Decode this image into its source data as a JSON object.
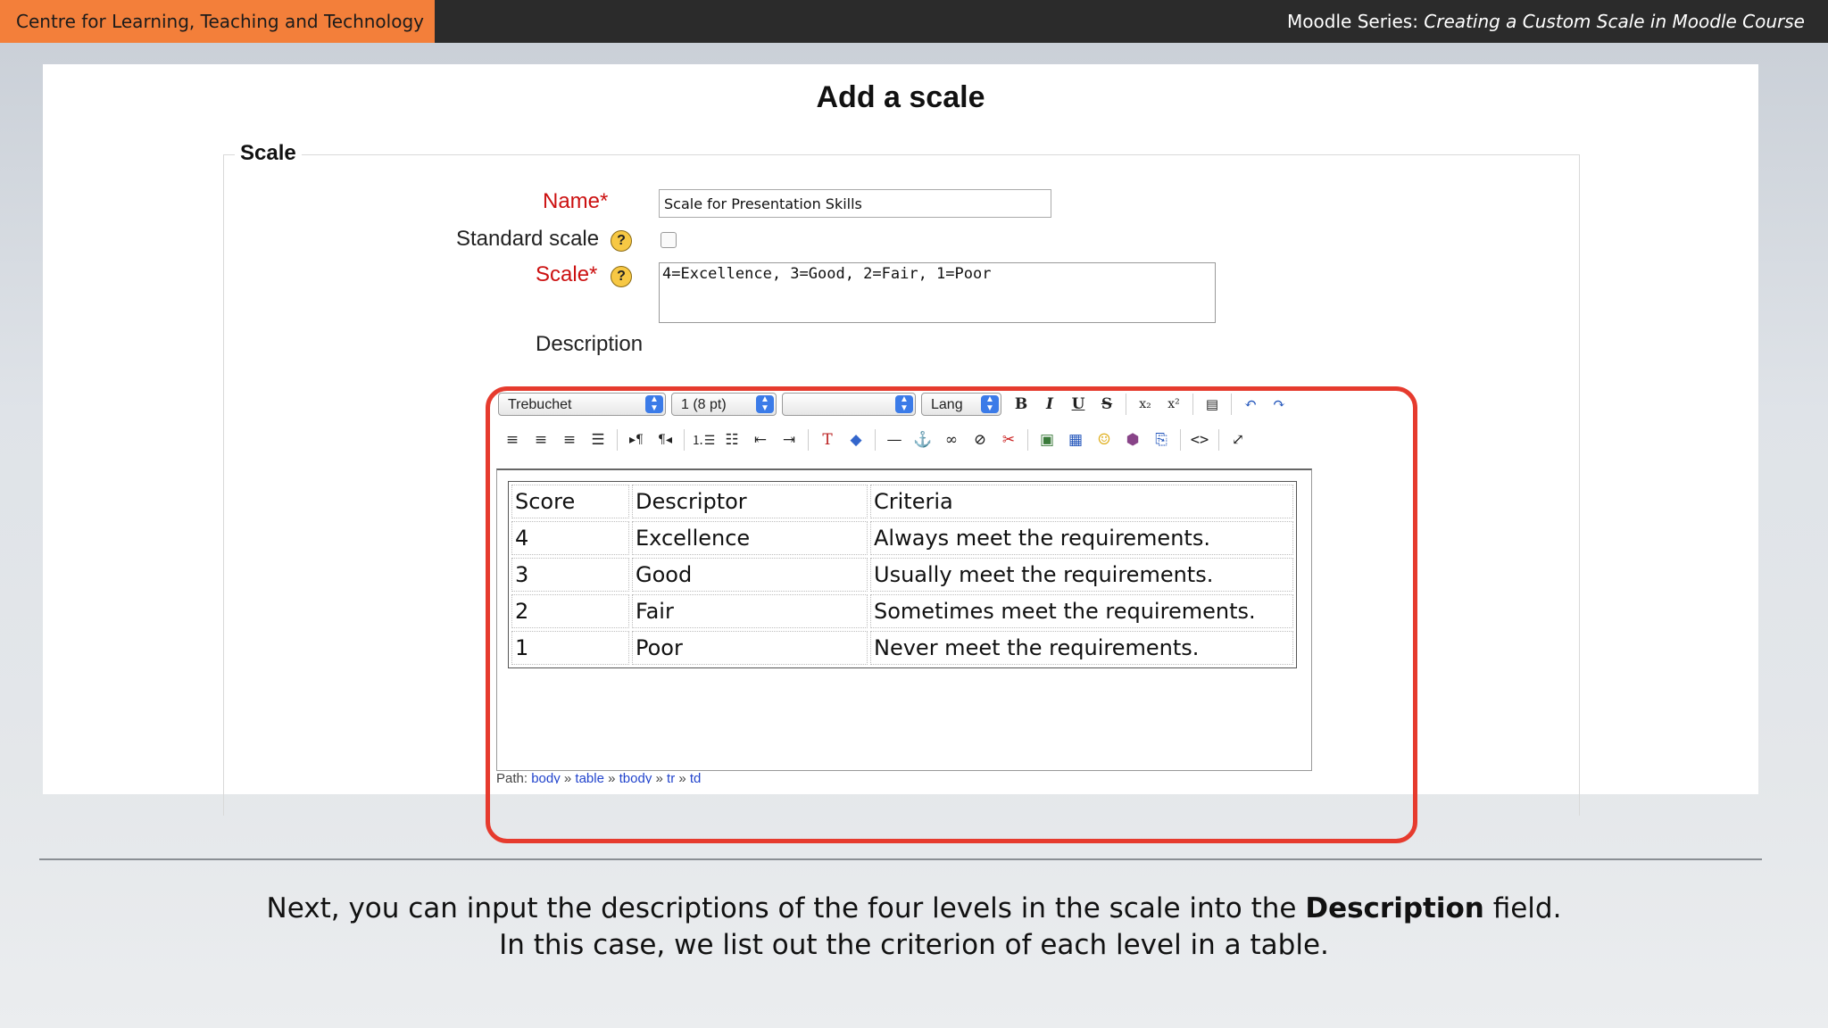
{
  "header": {
    "org": "Centre for Learning, Teaching and Technology",
    "series_prefix": "Moodle Series:",
    "series_title": "Creating a Custom Scale in Moodle Course"
  },
  "form": {
    "title": "Add a scale",
    "legend": "Scale",
    "name_label": "Name*",
    "name_value": "Scale for Presentation Skills",
    "standard_label": "Standard scale",
    "standard_checked": false,
    "scale_label": "Scale*",
    "scale_value": "4=Excellence, 3=Good, 2=Fair, 1=Poor",
    "description_label": "Description",
    "help_glyph": "?"
  },
  "editor": {
    "font_family": "Trebuchet",
    "font_size": "1 (8 pt)",
    "format": "",
    "lang": "Lang",
    "table_rows": [
      [
        "Score",
        "Descriptor",
        "Criteria"
      ],
      [
        "4",
        "Excellence",
        "Always meet the requirements."
      ],
      [
        "3",
        "Good",
        "Usually meet the requirements."
      ],
      [
        "2",
        "Fair",
        "Sometimes meet the requirements."
      ],
      [
        "1",
        "Poor",
        "Never meet the requirements."
      ]
    ],
    "path_label": "Path:",
    "path_items": [
      "body",
      "table",
      "tbody",
      "tr",
      "td"
    ]
  },
  "caption": {
    "line1_pre": "Next, you can input the descriptions of the four levels in the scale into the ",
    "line1_bold": "Description",
    "line1_post": " field.",
    "line2": "In this case, we list out the criterion of each level in a table."
  },
  "colors": {
    "accent_orange": "#f37f3a",
    "highlight_red": "#e63b2e",
    "required_red": "#cc1111"
  }
}
